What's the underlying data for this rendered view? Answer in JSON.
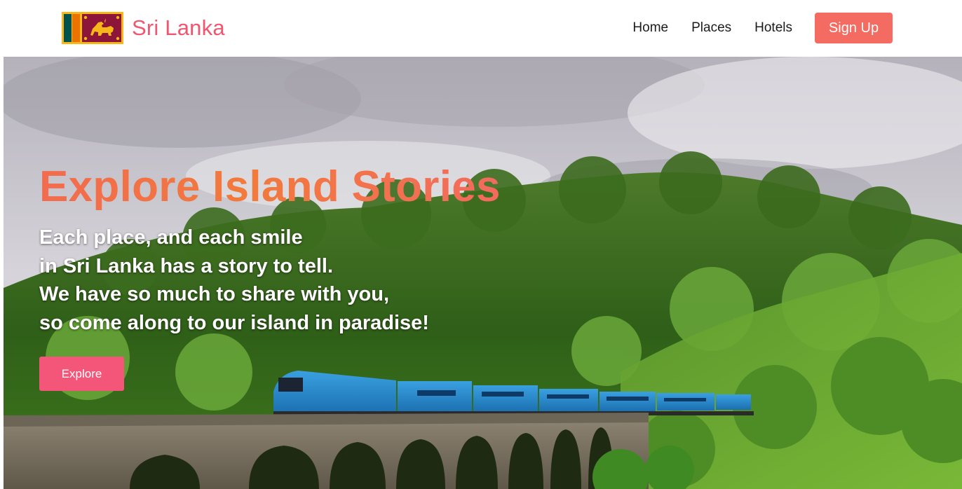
{
  "navbar": {
    "brand_name": "Sri Lanka",
    "links": [
      "Home",
      "Places",
      "Hotels"
    ],
    "signup_label": "Sign Up"
  },
  "hero": {
    "title": "Explore Island Stories",
    "lines": [
      "Each place, and each smile",
      "in Sri Lanka has a story to tell.",
      "We have so much to share with you,",
      "so come along to our island in paradise!"
    ],
    "button_label": "Explore"
  },
  "colors": {
    "brand": "#f0566f",
    "signup_button": "#f36b61",
    "explore_button": "#f4567a",
    "title_gradient": [
      "#f26b4f",
      "#f36a5f"
    ]
  },
  "icons": [
    "sri-lanka-flag-icon"
  ]
}
